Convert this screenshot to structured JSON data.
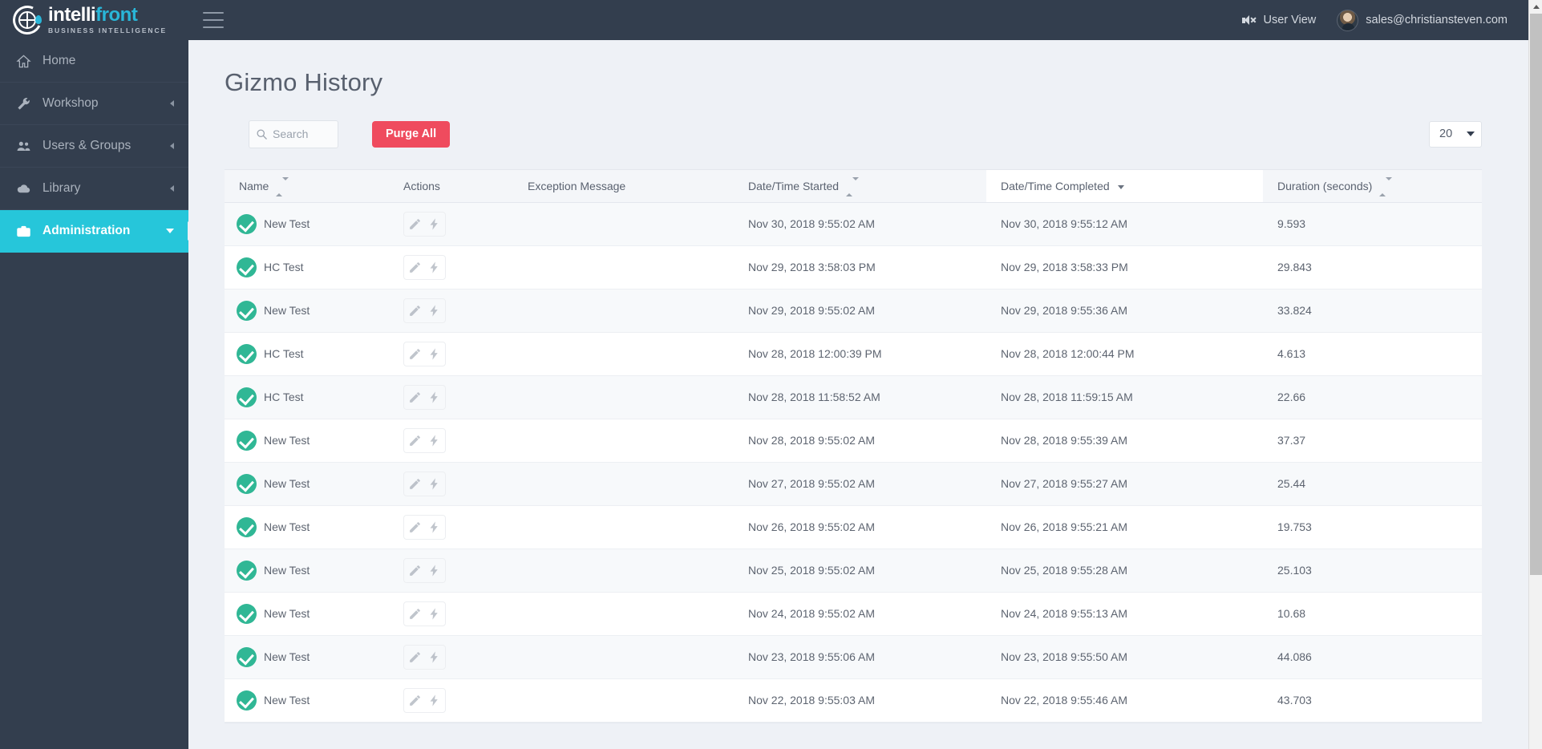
{
  "brand": {
    "word_part1": "intelli",
    "word_part2": "front",
    "tagline": "BUSINESS INTELLIGENCE",
    "accent_color": "#29b6d8",
    "topbar_color": "#333e4e"
  },
  "topbar": {
    "menu_toggle_name": "hamburger-menu",
    "user_view_label": "User View",
    "account_email": "sales@christiansteven.com"
  },
  "sidebar": {
    "items": [
      {
        "label": "Home",
        "icon": "home-icon",
        "expandable": false,
        "active": false
      },
      {
        "label": "Workshop",
        "icon": "wrench-icon",
        "expandable": true,
        "active": false
      },
      {
        "label": "Users & Groups",
        "icon": "users-icon",
        "expandable": true,
        "active": false
      },
      {
        "label": "Library",
        "icon": "cloud-icon",
        "expandable": true,
        "active": false
      },
      {
        "label": "Administration",
        "icon": "briefcase-icon",
        "expandable": true,
        "active": true
      }
    ],
    "active_color": "#26c6da"
  },
  "page": {
    "title": "Gizmo History"
  },
  "toolbar": {
    "search_placeholder": "Search",
    "search_value": "",
    "purge_label": "Purge All",
    "purge_color": "#ef4b5e",
    "page_size_value": "20"
  },
  "table": {
    "columns": [
      {
        "label": "Name",
        "sort": "both",
        "active": false
      },
      {
        "label": "Actions",
        "sort": "none",
        "active": false
      },
      {
        "label": "Exception Message",
        "sort": "none",
        "active": false
      },
      {
        "label": "Date/Time Started",
        "sort": "both",
        "active": false
      },
      {
        "label": "Date/Time Completed",
        "sort": "desc",
        "active": true
      },
      {
        "label": "Duration (seconds)",
        "sort": "both",
        "active": false
      }
    ],
    "rows": [
      {
        "status": "success",
        "name": "New Test",
        "exception": "",
        "started": "Nov 30, 2018 9:55:02 AM",
        "completed": "Nov 30, 2018 9:55:12 AM",
        "duration": "9.593"
      },
      {
        "status": "success",
        "name": "HC Test",
        "exception": "",
        "started": "Nov 29, 2018 3:58:03 PM",
        "completed": "Nov 29, 2018 3:58:33 PM",
        "duration": "29.843"
      },
      {
        "status": "success",
        "name": "New Test",
        "exception": "",
        "started": "Nov 29, 2018 9:55:02 AM",
        "completed": "Nov 29, 2018 9:55:36 AM",
        "duration": "33.824"
      },
      {
        "status": "success",
        "name": "HC Test",
        "exception": "",
        "started": "Nov 28, 2018 12:00:39 PM",
        "completed": "Nov 28, 2018 12:00:44 PM",
        "duration": "4.613"
      },
      {
        "status": "success",
        "name": "HC Test",
        "exception": "",
        "started": "Nov 28, 2018 11:58:52 AM",
        "completed": "Nov 28, 2018 11:59:15 AM",
        "duration": "22.66"
      },
      {
        "status": "success",
        "name": "New Test",
        "exception": "",
        "started": "Nov 28, 2018 9:55:02 AM",
        "completed": "Nov 28, 2018 9:55:39 AM",
        "duration": "37.37"
      },
      {
        "status": "success",
        "name": "New Test",
        "exception": "",
        "started": "Nov 27, 2018 9:55:02 AM",
        "completed": "Nov 27, 2018 9:55:27 AM",
        "duration": "25.44"
      },
      {
        "status": "success",
        "name": "New Test",
        "exception": "",
        "started": "Nov 26, 2018 9:55:02 AM",
        "completed": "Nov 26, 2018 9:55:21 AM",
        "duration": "19.753"
      },
      {
        "status": "success",
        "name": "New Test",
        "exception": "",
        "started": "Nov 25, 2018 9:55:02 AM",
        "completed": "Nov 25, 2018 9:55:28 AM",
        "duration": "25.103"
      },
      {
        "status": "success",
        "name": "New Test",
        "exception": "",
        "started": "Nov 24, 2018 9:55:02 AM",
        "completed": "Nov 24, 2018 9:55:13 AM",
        "duration": "10.68"
      },
      {
        "status": "success",
        "name": "New Test",
        "exception": "",
        "started": "Nov 23, 2018 9:55:06 AM",
        "completed": "Nov 23, 2018 9:55:50 AM",
        "duration": "44.086"
      },
      {
        "status": "success",
        "name": "New Test",
        "exception": "",
        "started": "Nov 22, 2018 9:55:03 AM",
        "completed": "Nov 22, 2018 9:55:46 AM",
        "duration": "43.703"
      }
    ],
    "row_action_icons": [
      "pencil-icon",
      "lightning-bolt-icon"
    ]
  }
}
